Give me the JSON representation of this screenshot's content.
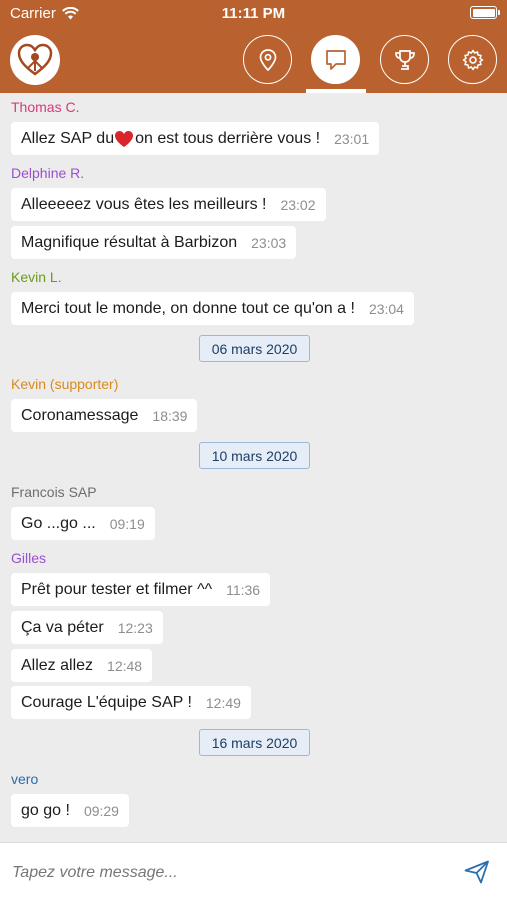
{
  "status_bar": {
    "carrier": "Carrier",
    "time": "11:11 PM"
  },
  "header": {
    "nav_buttons": [
      {
        "icon": "location-pin-icon",
        "active": false
      },
      {
        "icon": "chat-bubble-icon",
        "active": true
      },
      {
        "icon": "trophy-icon",
        "active": false
      },
      {
        "icon": "gear-icon",
        "active": false
      }
    ]
  },
  "colors": {
    "header_bg": "#b9622f",
    "date_border": "#9bb8d8",
    "send_icon": "#2a6fb0"
  },
  "chat": {
    "senders": [
      {
        "name": "Thomas C.",
        "color": "#d63a7a"
      },
      {
        "name": "Delphine R.",
        "color": "#9a4fd0"
      },
      {
        "name": "Kevin L.",
        "color": "#6b9a1e"
      },
      {
        "name": "Kevin (supporter)",
        "color": "#d98a1e"
      },
      {
        "name": "Francois SAP",
        "color": "#6e6e6e"
      },
      {
        "name": "Gilles",
        "color": "#9a4fd0"
      },
      {
        "name": "vero",
        "color": "#2c6aa8"
      }
    ],
    "messages": [
      {
        "text_before": "Allez SAP du ",
        "text_after": "on est tous derrière vous !",
        "time": "23:01"
      },
      {
        "text": "Alleeeeez vous êtes les meilleurs !",
        "time": "23:02"
      },
      {
        "text": "Magnifique résultat à Barbizon",
        "time": "23:03"
      },
      {
        "text": "Merci tout le monde, on donne tout ce qu'on a !",
        "time": "23:04"
      },
      {
        "text": "Coronamessage",
        "time": "18:39"
      },
      {
        "text": "Go ...go ...",
        "time": "09:19"
      },
      {
        "text": "Prêt pour tester et filmer ^^",
        "time": "11:36"
      },
      {
        "text": "Ça va péter",
        "time": "12:23"
      },
      {
        "text": "Allez allez",
        "time": "12:48"
      },
      {
        "text": "Courage L'équipe SAP !",
        "time": "12:49"
      },
      {
        "text": "go go !",
        "time": "09:29"
      }
    ],
    "date_separators": [
      "06 mars 2020",
      "10 mars 2020",
      "16 mars 2020"
    ]
  },
  "composer": {
    "placeholder": "Tapez votre message..."
  }
}
